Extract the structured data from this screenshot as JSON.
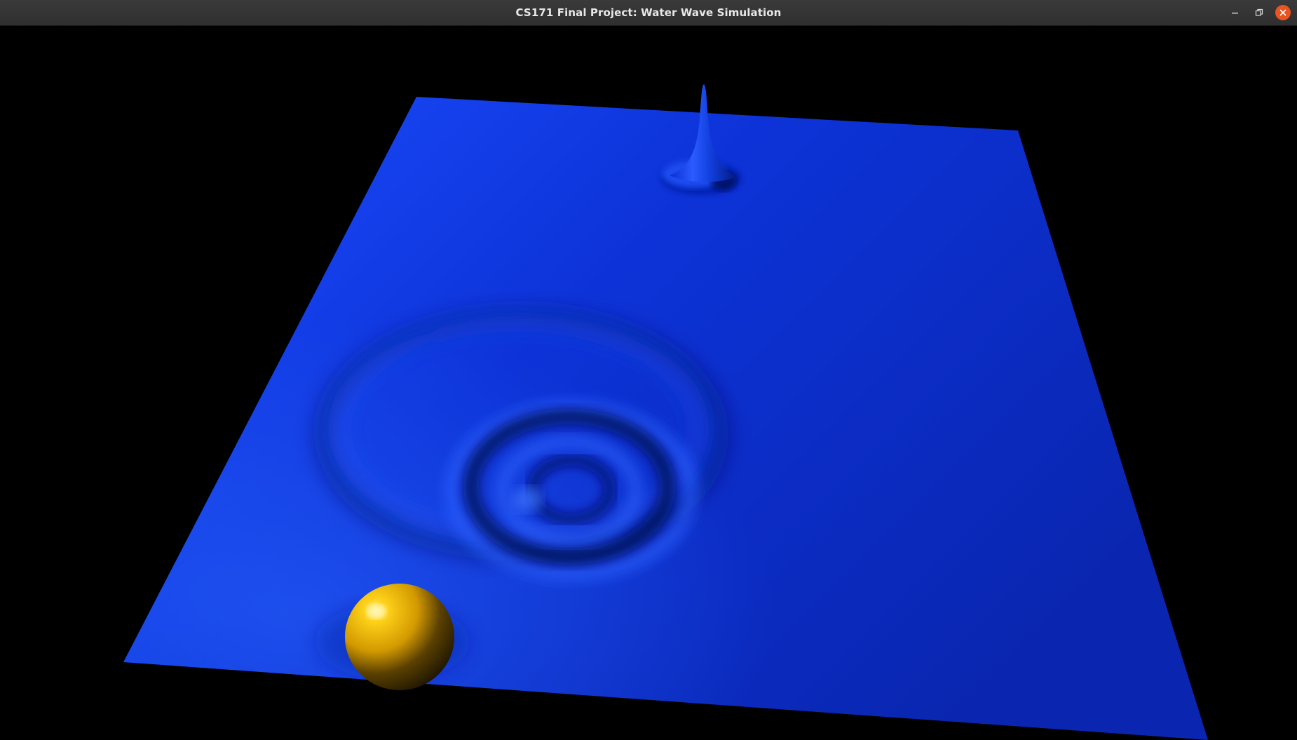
{
  "window": {
    "title": "CS171 Final Project: Water Wave Simulation",
    "controls": {
      "minimize_icon": "minimize-icon",
      "maximize_icon": "restore-icon",
      "close_icon": "close-icon"
    },
    "colors": {
      "titlebar": "#303030",
      "title_text": "#e8e8e8",
      "close_button": "#e95420"
    }
  },
  "scene": {
    "background_color": "#000000",
    "water_color": "#0a2be6",
    "sphere_color": "#f2b000",
    "objects": [
      "water-surface",
      "ripple-rings",
      "wave-peak",
      "sphere"
    ]
  }
}
